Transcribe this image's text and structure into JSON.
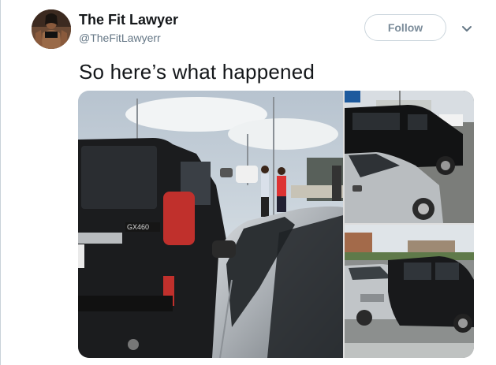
{
  "author": {
    "display_name": "The Fit Lawyer",
    "handle": "@TheFitLawyerr"
  },
  "actions": {
    "follow_label": "Follow",
    "more_icon": "chevron-down-icon"
  },
  "tweet": {
    "text": "So here’s what happened"
  },
  "media": {
    "main_photo_plate_text": "GX460"
  }
}
